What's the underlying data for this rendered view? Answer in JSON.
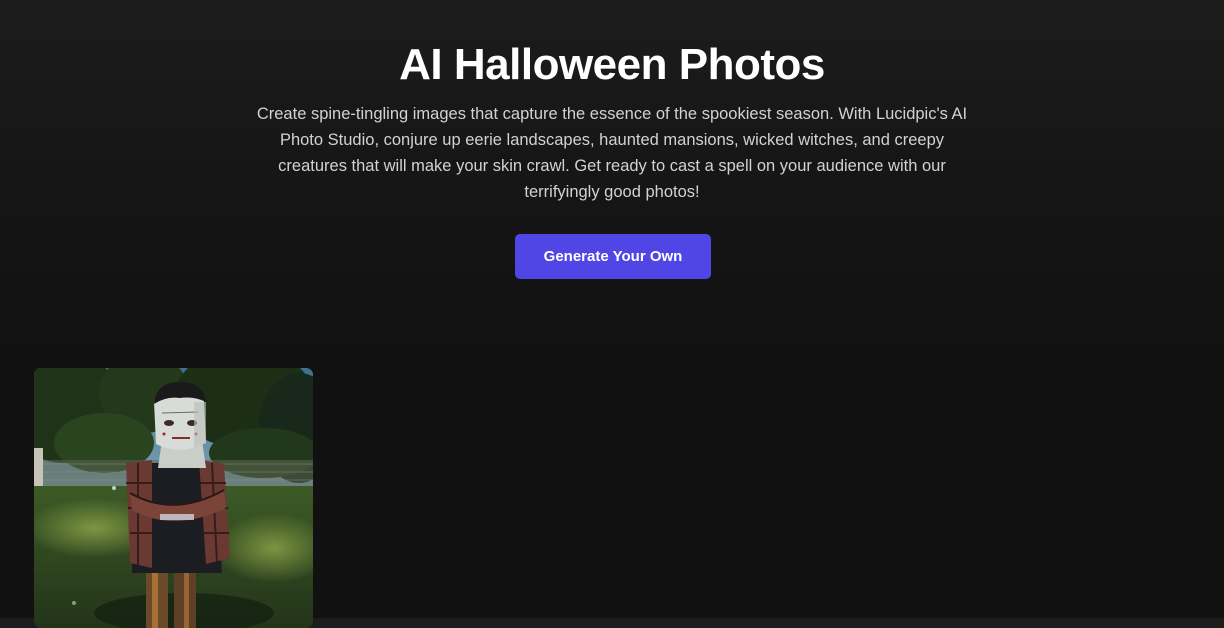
{
  "hero": {
    "title": "AI Halloween Photos",
    "description": "Create spine-tingling images that capture the essence of the spookiest season. With Lucidpic's AI Photo Studio, conjure up eerie landscapes, haunted mansions, wicked witches, and creepy creatures that will make your skin crawl. Get ready to cast a spell on your audience with our terrifyingly good photos!",
    "cta_label": "Generate Your Own"
  },
  "colors": {
    "background": "#111112",
    "accent": "#4f46e5",
    "text": "#ffffff",
    "muted_text": "#d2d2d2"
  },
  "gallery": {
    "items": [
      {
        "subject": "person in frankenstein mask and plaid shirt standing in sunlit backyard"
      }
    ]
  }
}
